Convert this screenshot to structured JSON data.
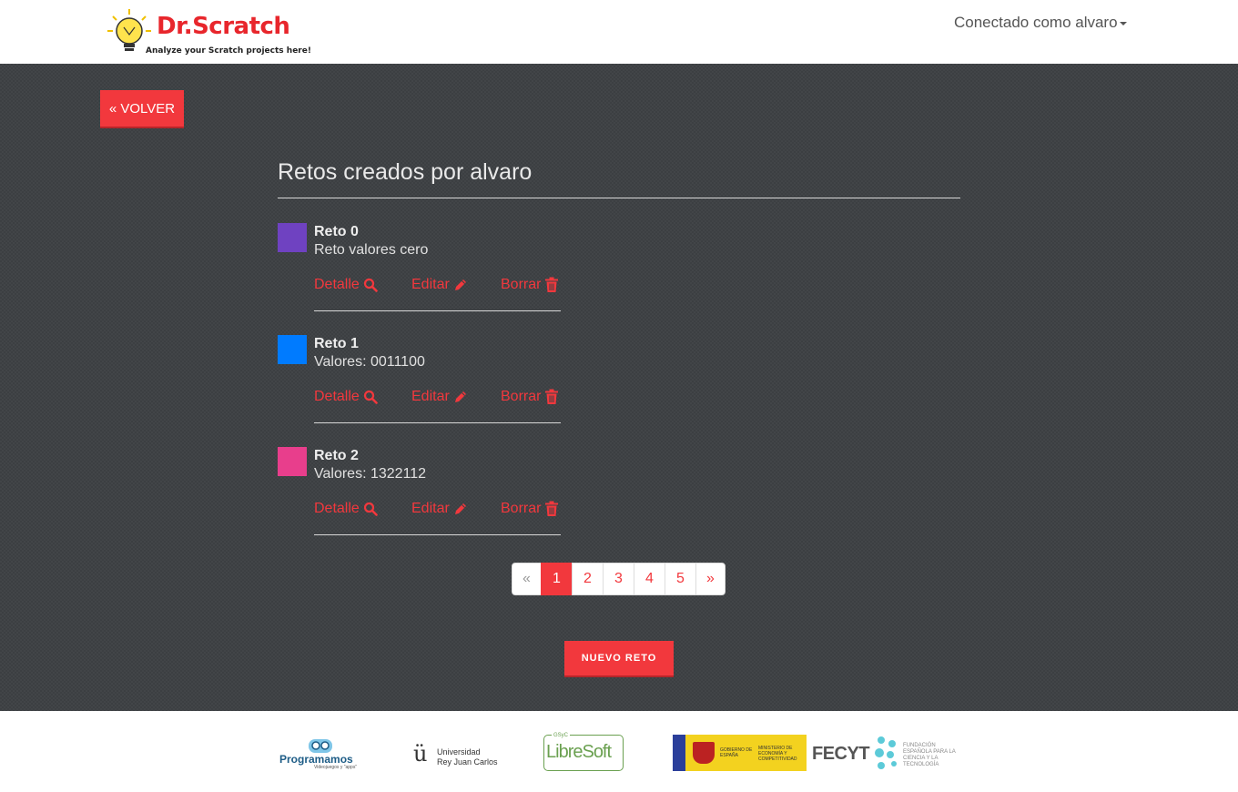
{
  "header": {
    "logo_title": "Dr.Scratch",
    "logo_subtitle": "Analyze your Scratch projects here!",
    "user_menu_label": "Conectado como alvaro"
  },
  "main": {
    "back_label": "« VOLVER",
    "title": "Retos creados por alvaro",
    "retos": [
      {
        "name": "Reto 0",
        "description": "Reto valores cero",
        "color": "#6f42c1"
      },
      {
        "name": "Reto 1",
        "description": "Valores: 0011100",
        "color": "#007bff"
      },
      {
        "name": "Reto 2",
        "description": "Valores: 1322112",
        "color": "#e83e8c"
      }
    ],
    "actions": {
      "detail": "Detalle",
      "edit": "Editar",
      "delete": "Borrar"
    },
    "pagination": {
      "prev": "«",
      "pages": [
        "1",
        "2",
        "3",
        "4",
        "5"
      ],
      "next": "»",
      "current": "1"
    },
    "new_label": "NUEVO RETO"
  },
  "footer": {
    "programamos": "Programamos",
    "programamos_sub": "Videojuegos y \"apps\"",
    "urjc_line1": "Universidad",
    "urjc_line2": "Rey Juan Carlos",
    "libresoft": "LibreSoft",
    "libresoft_top": "GSyC",
    "gobierno": "GOBIERNO DE ESPAÑA",
    "ministerio": "MINISTERIO DE ECONOMÍA Y COMPETITIVIDAD",
    "fecyt": "FECYT",
    "fecyt_sub": "FUNDACIÓN ESPAÑOLA PARA LA CIENCIA Y LA TECNOLOGÍA"
  },
  "colors": {
    "accent": "#f2383d",
    "background_dark": "#3c3f42"
  }
}
